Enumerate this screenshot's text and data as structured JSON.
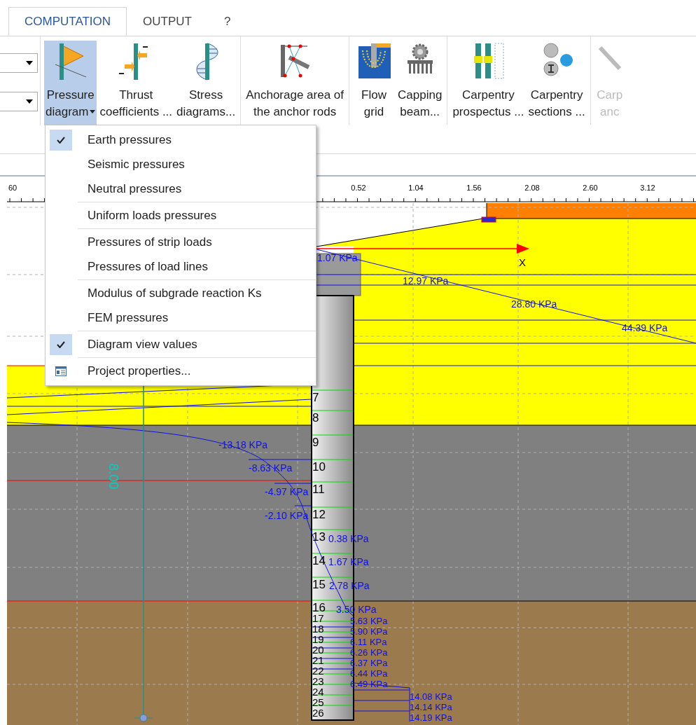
{
  "tabs": [
    {
      "label": "COMPUTATION",
      "selected": true
    },
    {
      "label": "OUTPUT",
      "selected": false
    },
    {
      "label": "?",
      "selected": false
    }
  ],
  "ribbon": {
    "combo_boxes": [
      {
        "kind": "dropdown"
      },
      {
        "kind": "dropdown"
      }
    ],
    "groups": [
      [
        {
          "lines": [
            "Pressure",
            "diagram"
          ],
          "kind": "pressure",
          "selected": true,
          "disabled": false,
          "has_menu": true
        },
        {
          "lines": [
            "Thrust",
            "coefficients ..."
          ],
          "kind": "thrust",
          "selected": false,
          "disabled": false,
          "has_menu": false
        },
        {
          "lines": [
            "Stress",
            "diagrams..."
          ],
          "kind": "stress",
          "selected": false,
          "disabled": false,
          "has_menu": false
        }
      ],
      [
        {
          "lines": [
            "Anchorage area of",
            "the anchor rods"
          ],
          "kind": "anchor",
          "selected": false,
          "disabled": false,
          "has_menu": false
        }
      ],
      [
        {
          "lines": [
            "Flow",
            "grid"
          ],
          "kind": "flow",
          "selected": false,
          "disabled": false,
          "has_menu": false
        },
        {
          "lines": [
            "Capping",
            "beam..."
          ],
          "kind": "capping",
          "selected": false,
          "disabled": false,
          "has_menu": false
        }
      ],
      [
        {
          "lines": [
            "Carpentry",
            "prospectus ..."
          ],
          "kind": "prospectus",
          "selected": false,
          "disabled": false,
          "has_menu": false
        },
        {
          "lines": [
            "Carpentry",
            "sections ..."
          ],
          "kind": "sections",
          "selected": false,
          "disabled": false,
          "has_menu": false
        }
      ],
      [
        {
          "lines": [
            "Carp",
            "anc"
          ],
          "kind": "rod",
          "selected": false,
          "disabled": true,
          "has_menu": false
        }
      ]
    ]
  },
  "menu": {
    "groups": [
      [
        {
          "label": "Earth pressures",
          "kind": "check",
          "checked": true
        },
        {
          "label": "Seismic pressures",
          "kind": "check",
          "checked": false
        },
        {
          "label": "Neutral pressures",
          "kind": "check",
          "checked": false
        }
      ],
      [
        {
          "label": "Uniform loads pressures",
          "kind": "check",
          "checked": false
        }
      ],
      [
        {
          "label": "Pressures of strip loads",
          "kind": "check",
          "checked": false
        },
        {
          "label": "Pressures of load lines",
          "kind": "check",
          "checked": false
        }
      ],
      [
        {
          "label": "Modulus of subgrade reaction Ks",
          "kind": "check",
          "checked": false
        },
        {
          "label": "FEM pressures",
          "kind": "check",
          "checked": false
        }
      ],
      [
        {
          "label": "Diagram view values",
          "kind": "check",
          "checked": true
        }
      ],
      [
        {
          "label": "Project properties...",
          "kind": "command"
        }
      ]
    ]
  },
  "canvas": {
    "ruler_labels": [
      "60",
      "0.52",
      "1.04",
      "1.56",
      "2.08",
      "2.60",
      "3.12"
    ],
    "axis_label": "X",
    "dimension": "8.00",
    "pressure_labels": [
      "1.07 KPa",
      "12.97 KPa",
      "28.80 KPa",
      "44.39 KPa",
      "-13.18 KPa",
      "-8.63 KPa",
      "-4.97 KPa",
      "-2.10 KPa",
      "0.38 KPa",
      "1.67 KPa",
      "2.78 KPa",
      "3.50 KPa",
      "5.63 KPa",
      "5.90 KPa",
      "6.11 KPa",
      "6.26 KPa",
      "6.37 KPa",
      "6.44 KPa",
      "6.49 KPa",
      "14.08 KPa",
      "14.14 KPa",
      "14.19 KPa"
    ],
    "wall_numbers": [
      "7",
      "8",
      "9",
      "10",
      "11",
      "12",
      "13",
      "14",
      "15",
      "16",
      "17",
      "18",
      "19",
      "20",
      "21",
      "22",
      "23",
      "24",
      "25",
      "26"
    ]
  }
}
